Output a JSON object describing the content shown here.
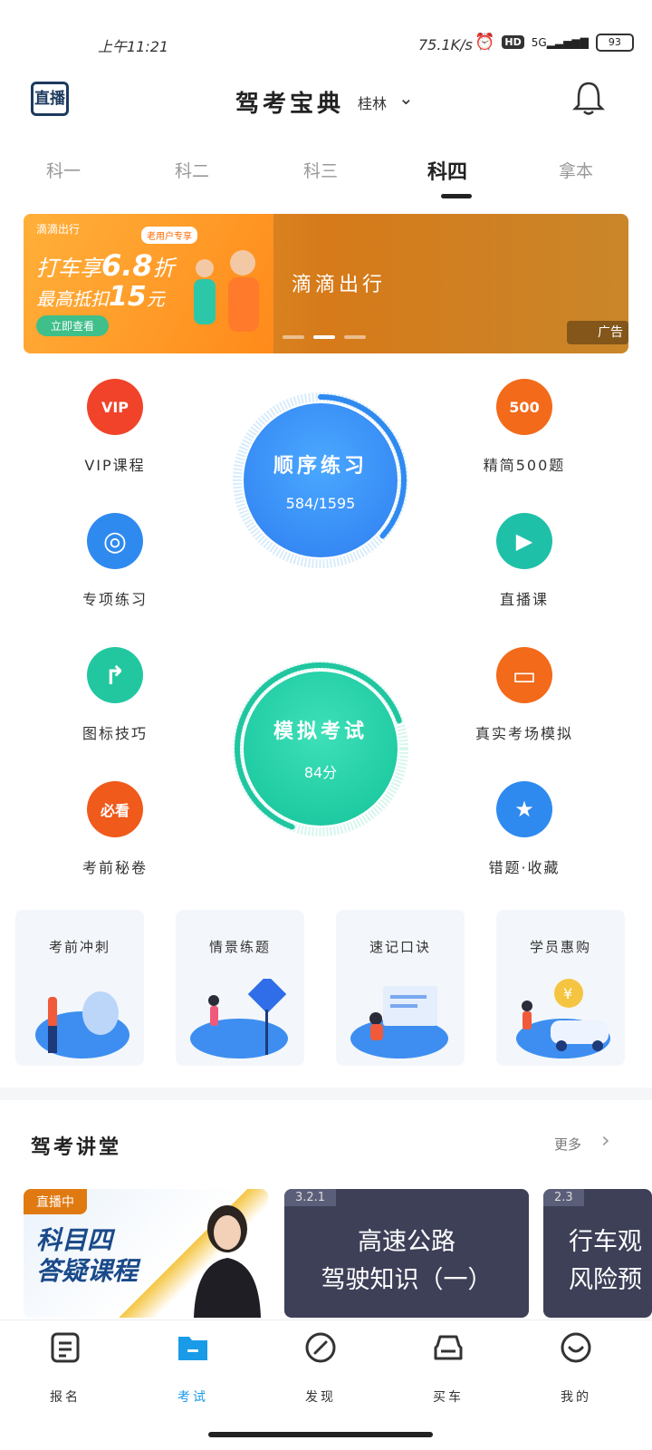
{
  "status": {
    "time": "上午11:21",
    "net_speed": "75.1K/s",
    "hd": "HD",
    "signal": "5G",
    "battery": "93"
  },
  "header": {
    "live_label": "直播",
    "title": "驾考宝典",
    "city": "桂林"
  },
  "tabs": [
    {
      "label": "科一"
    },
    {
      "label": "科二"
    },
    {
      "label": "科三"
    },
    {
      "label": "科四"
    },
    {
      "label": "拿本"
    }
  ],
  "active_tab": "科四",
  "banner": {
    "brand": "滴滴出行",
    "tag": "老用户专享",
    "line1_prefix": "打车享",
    "line1_num": "6.8",
    "line1_suffix": "折",
    "line2_prefix": "最高抵扣",
    "line2_num": "15",
    "line2_suffix": "元",
    "button": "立即查看",
    "middle_text": "滴滴出行",
    "ad_label": "广告"
  },
  "features_left": [
    {
      "label": "VIP课程",
      "icon": "vip-icon",
      "color": "#f0432a",
      "text": "VIP"
    },
    {
      "label": "专项练习",
      "icon": "target-icon",
      "color": "#2f8af0",
      "text": "◎"
    },
    {
      "label": "图标技巧",
      "icon": "turn-sign-icon",
      "color": "#22c7a0",
      "text": "↱"
    },
    {
      "label": "考前秘卷",
      "icon": "must-see-icon",
      "color": "#f05a1a",
      "text": "必看"
    }
  ],
  "features_right": [
    {
      "label": "精简500题",
      "icon": "500-icon",
      "color": "#f26a1a",
      "text": "500"
    },
    {
      "label": "直播课",
      "icon": "video-icon",
      "color": "#1fc0a8",
      "text": "▶"
    },
    {
      "label": "真实考场模拟",
      "icon": "monitor-icon",
      "color": "#f26a1a",
      "text": "▭"
    },
    {
      "label": "错题·收藏",
      "icon": "star-bookmark-icon",
      "color": "#2f8af0",
      "text": "★"
    }
  ],
  "practice": {
    "title": "顺序练习",
    "progress": "584/1595",
    "progress_fraction": 0.366
  },
  "exam": {
    "title": "模拟考试",
    "score": "84分"
  },
  "cards": [
    {
      "label": "考前冲刺"
    },
    {
      "label": "情景练题"
    },
    {
      "label": "速记口诀"
    },
    {
      "label": "学员惠购"
    }
  ],
  "lecture": {
    "title": "驾考讲堂",
    "more": "更多"
  },
  "videos": [
    {
      "badge": "直播中",
      "title_line1": "科目四",
      "title_line2": "答疑课程"
    },
    {
      "badge": "3.2.1",
      "title_line1": "高速公路",
      "title_line2": "驾驶知识（一）"
    },
    {
      "badge": "2.3",
      "title_line1": "行车观",
      "title_line2": "风险预"
    }
  ],
  "nav": [
    {
      "label": "报名",
      "icon": "signup-icon"
    },
    {
      "label": "考试",
      "icon": "folder-icon"
    },
    {
      "label": "发现",
      "icon": "compass-icon"
    },
    {
      "label": "买车",
      "icon": "car-icon"
    },
    {
      "label": "我的",
      "icon": "smile-icon"
    }
  ],
  "active_nav": "考试",
  "colors": {
    "accent": "#1a9be8",
    "practice": "#2f8af0",
    "exam": "#1fc6a0"
  }
}
